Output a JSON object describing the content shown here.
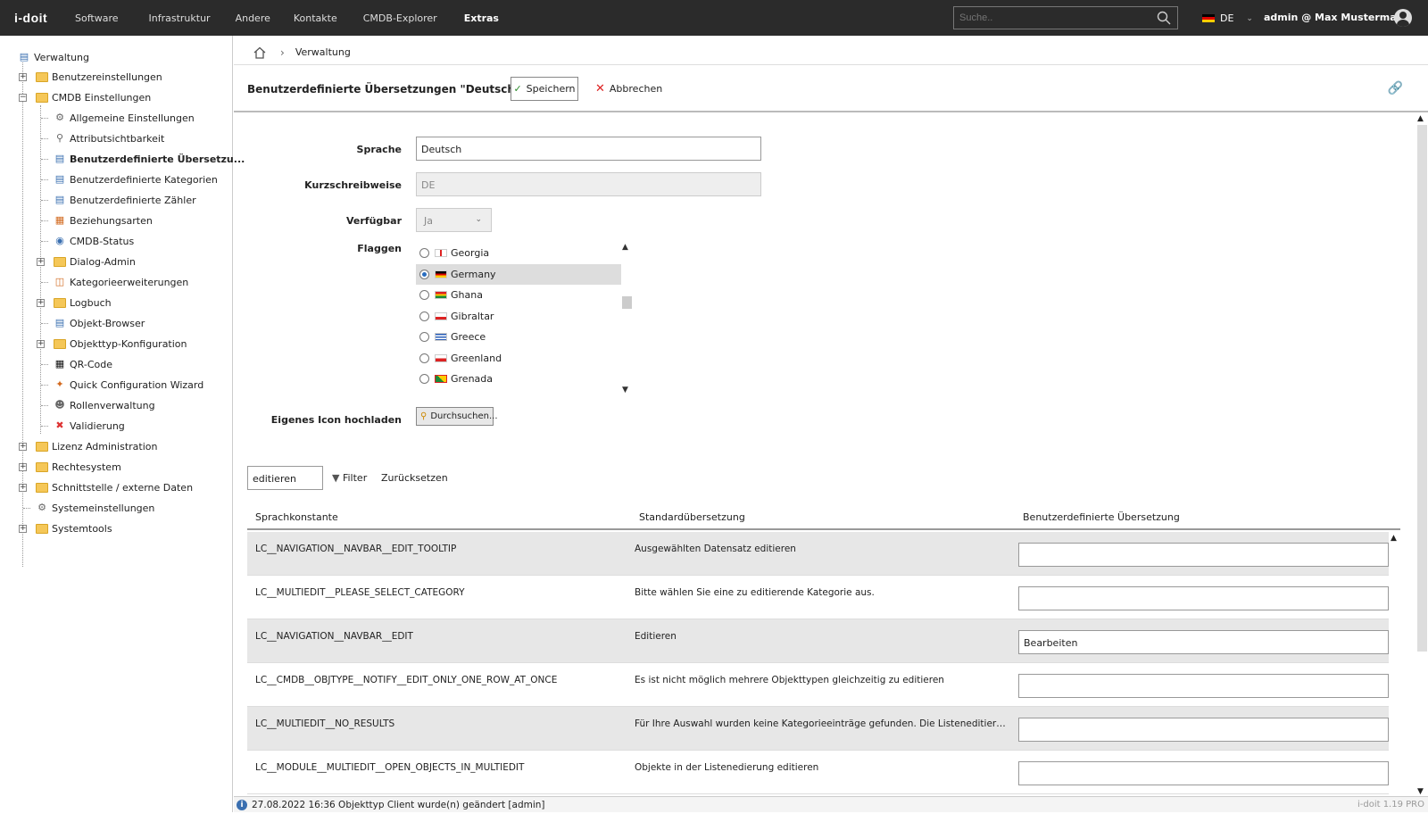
{
  "topbar": {
    "logo": "i-doit",
    "nav": [
      "Software",
      "Infrastruktur",
      "Andere",
      "Kontakte",
      "CMDB-Explorer",
      "Extras"
    ],
    "search_placeholder": "Suche..",
    "language": "DE",
    "user": "admin @ Max Mustermann"
  },
  "sidebar": {
    "root": "Verwaltung",
    "items": [
      {
        "label": "Benutzereinstellungen"
      },
      {
        "label": "CMDB Einstellungen"
      },
      {
        "label": "Allgemeine Einstellungen"
      },
      {
        "label": "Attributsichtbarkeit"
      },
      {
        "label": "Benutzerdefinierte Übersetzu..."
      },
      {
        "label": "Benutzerdefinierte Kategorien"
      },
      {
        "label": "Benutzerdefinierte Zähler"
      },
      {
        "label": "Beziehungsarten"
      },
      {
        "label": "CMDB-Status"
      },
      {
        "label": "Dialog-Admin"
      },
      {
        "label": "Kategorieerweiterungen"
      },
      {
        "label": "Logbuch"
      },
      {
        "label": "Objekt-Browser"
      },
      {
        "label": "Objekttyp-Konfiguration"
      },
      {
        "label": "QR-Code"
      },
      {
        "label": "Quick Configuration Wizard"
      },
      {
        "label": "Rollenverwaltung"
      },
      {
        "label": "Validierung"
      },
      {
        "label": "Lizenz Administration"
      },
      {
        "label": "Rechtesystem"
      },
      {
        "label": "Schnittstelle / externe Daten"
      },
      {
        "label": "Systemeinstellungen"
      },
      {
        "label": "Systemtools"
      }
    ]
  },
  "breadcrumb": {
    "current": "Verwaltung"
  },
  "header": {
    "title": "Benutzerdefinierte Übersetzungen \"Deutsch\"",
    "save": "Speichern",
    "cancel": "Abbrechen"
  },
  "form": {
    "sprache_label": "Sprache",
    "sprache_value": "Deutsch",
    "kurz_label": "Kurzschreibweise",
    "kurz_value": "DE",
    "verf_label": "Verfügbar",
    "verf_value": "Ja",
    "flaggen_label": "Flaggen",
    "flags": [
      "Georgia",
      "Germany",
      "Ghana",
      "Gibraltar",
      "Greece",
      "Greenland",
      "Grenada"
    ],
    "selected_flag": "Germany",
    "icon_label": "Eigenes Icon hochladen",
    "browse": "Durchsuchen..."
  },
  "filter": {
    "value": "editieren",
    "filter_label": "Filter",
    "reset_label": "Zurücksetzen"
  },
  "table": {
    "headers": [
      "Sprachkonstante",
      "Standardübersetzung",
      "Benutzerdefinierte Übersetzung"
    ],
    "rows": [
      {
        "const": "LC__NAVIGATION__NAVBAR__EDIT_TOOLTIP",
        "std": "Ausgewählten Datensatz editieren",
        "custom": ""
      },
      {
        "const": "LC__MULTIEDIT__PLEASE_SELECT_CATEGORY",
        "std": "Bitte wählen Sie eine zu editierende Kategorie aus.",
        "custom": ""
      },
      {
        "const": "LC__NAVIGATION__NAVBAR__EDIT",
        "std": "Editieren",
        "custom": "Bearbeiten"
      },
      {
        "const": "LC__CMDB__OBJTYPE__NOTIFY__EDIT_ONLY_ONE_ROW_AT_ONCE",
        "std": "Es ist nicht möglich mehrere Objekttypen gleichzeitig zu editieren",
        "custom": ""
      },
      {
        "const": "LC__MULTIEDIT__NO_RESULTS",
        "std": "Für Ihre Auswahl wurden keine Kategorieeinträge gefunden. Die Listeneditierung ermögl...",
        "custom": ""
      },
      {
        "const": "LC__MODULE__MULTIEDIT__OPEN_OBJECTS_IN_MULTIEDIT",
        "std": "Objekte in der Listenedierung editieren",
        "custom": ""
      }
    ]
  },
  "status": {
    "message": "27.08.2022 16:36 Objekttyp Client wurde(n) geändert [admin]",
    "version": "i-doit 1.19 PRO"
  }
}
